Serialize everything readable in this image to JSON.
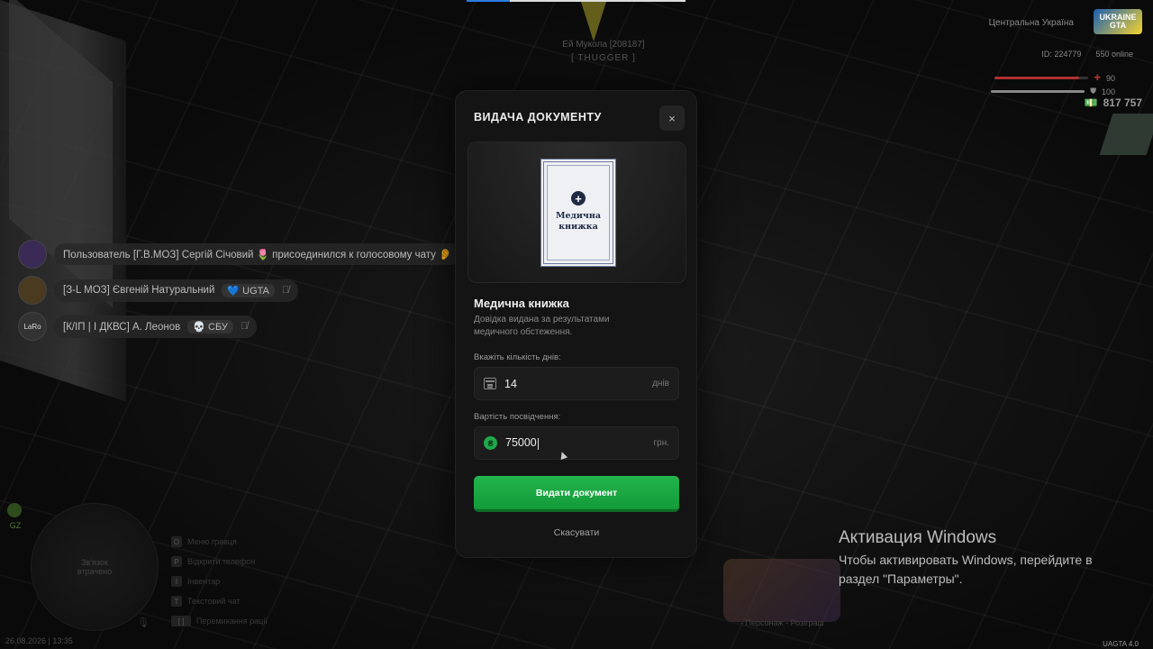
{
  "hud": {
    "region": "Центральна Україна",
    "logo_text": "UKRAINE GTA",
    "player_id": "ID: 224779",
    "online": "550 online",
    "health": "90",
    "armor": "100",
    "health_level": 0.9,
    "armor_level": 1.0,
    "money": "817 757",
    "version": "UAGTA 4.0",
    "date_time": "26.08.2026 | 13:35"
  },
  "player_tag": {
    "name": "Ей Мукола [208187]",
    "rank": "[ THUGGER ]"
  },
  "chat": [
    {
      "avatar": "",
      "text": "Пользователь [Г.В.МОЗ] Сергій Січовий 🌷 присоединился к голосовому чату 👂",
      "chip": ""
    },
    {
      "avatar": "",
      "text": "[З-L МОЗ] Євгеній Натуральний",
      "chip": "💙 UGTA"
    },
    {
      "avatar": "LaRo",
      "text": "[К/ІП | Ⅰ ДКВС] А. Леонов",
      "chip": "💀 СБУ"
    }
  ],
  "minimap": {
    "gz": "GZ",
    "no_signal": "Зв'язок втрачено"
  },
  "binds": [
    {
      "key": "O",
      "label": "Меню гравця"
    },
    {
      "key": "P",
      "label": "Відкрити телефон"
    },
    {
      "key": "I",
      "label": "Інвентар"
    },
    {
      "key": "T",
      "label": "Текстовий чат"
    },
    {
      "key": "[ ]",
      "label": "Перемикання рації"
    }
  ],
  "promo_text": "- Персонаж - Розіграш",
  "activation": {
    "title": "Активация Windows",
    "line1": "Чтобы активировать Windows, перейдите в",
    "line2": "раздел \"Параметры\"."
  },
  "modal": {
    "title": "ВИДАЧА ДОКУМЕНТУ",
    "close": "×",
    "doc_plus": "+",
    "doc_preview_title": "Медична книжка",
    "doc_name": "Медична книжка",
    "doc_desc": "Довідка видана за результатами медичного обстеження.",
    "days_label": "Вкажіть кількість днів:",
    "days_value": "14",
    "days_unit": "днів",
    "price_label": "Вартість посвідчення:",
    "price_value": "75000",
    "price_unit": "грн.",
    "coin_glyph": "₴",
    "submit": "Видати документ",
    "cancel": "Скасувати"
  },
  "colors": {
    "accent_green": "#1fa84a",
    "modal_bg": "#141414"
  }
}
